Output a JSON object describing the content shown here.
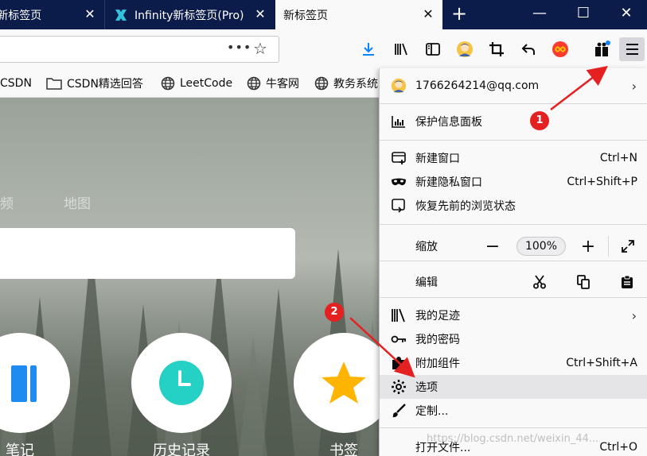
{
  "tabs": [
    {
      "label": "y新标签页",
      "close": "✕"
    },
    {
      "label": "Infinity新标签页(Pro)",
      "close": "✕"
    },
    {
      "label": "新标签页",
      "close": "✕"
    }
  ],
  "new_tab": "+",
  "window_controls": {
    "minimize": "—",
    "maximize": "☐",
    "close": "✕"
  },
  "urlbar": {
    "value": "",
    "more": "•••",
    "star": "☆"
  },
  "bookmarks": [
    "CSDN",
    "CSDN精选回答",
    "LeetCode",
    "牛客网",
    "教务系统"
  ],
  "page": {
    "nav_links": [
      "频",
      "地图"
    ],
    "shortcuts": [
      "笔记",
      "历史记录",
      "书签"
    ]
  },
  "menu": {
    "account": "1766264214@qq.com",
    "protections": "保护信息面板",
    "new_window": {
      "label": "新建窗口",
      "shortcut": "Ctrl+N"
    },
    "new_private": {
      "label": "新建隐私窗口",
      "shortcut": "Ctrl+Shift+P"
    },
    "restore": "恢复先前的浏览状态",
    "zoom": {
      "label": "缩放",
      "value": "100%",
      "minus": "−",
      "plus": "+"
    },
    "edit": "编辑",
    "library": "我的足迹",
    "passwords": "我的密码",
    "addons": {
      "label": "附加组件",
      "shortcut": "Ctrl+Shift+A"
    },
    "options": "选项",
    "customize": "定制...",
    "open_file": {
      "label": "打开文件...",
      "shortcut": "Ctrl+O"
    }
  },
  "annotations": {
    "step1": "1",
    "step2": "2",
    "color": "#e42020"
  },
  "watermark": "https://blog.csdn.net/weixin_44..."
}
